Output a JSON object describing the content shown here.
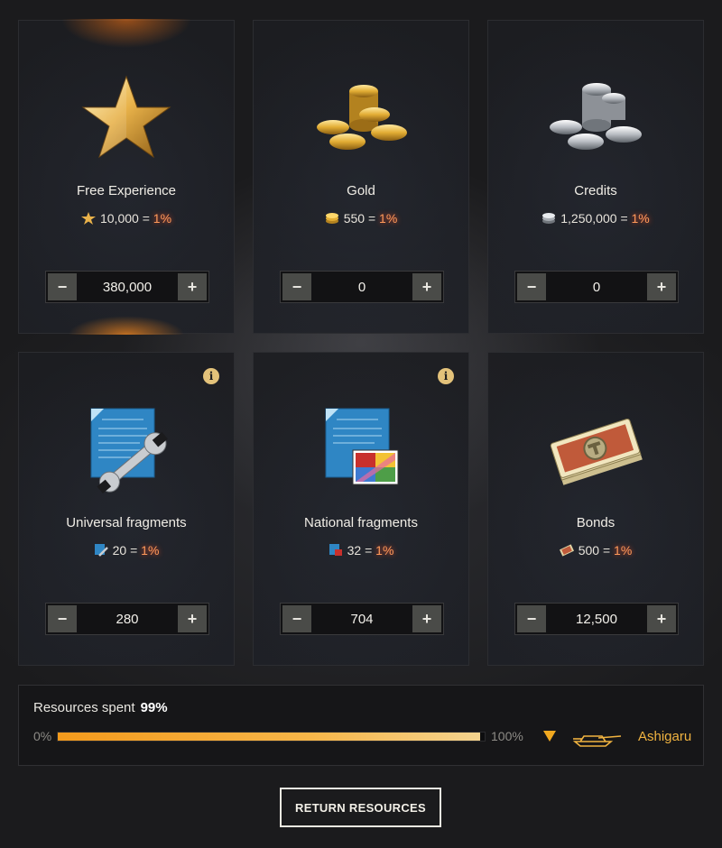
{
  "cards": [
    {
      "title": "Free Experience",
      "rate_amount": "10,000",
      "rate_eq": "=",
      "rate_pct": "1%",
      "value": "380,000",
      "icon": "star-icon",
      "minus": "−",
      "plus": "+"
    },
    {
      "title": "Gold",
      "rate_amount": "550",
      "rate_eq": "=",
      "rate_pct": "1%",
      "value": "0",
      "icon": "gold-coins-icon",
      "minus": "−",
      "plus": "+"
    },
    {
      "title": "Credits",
      "rate_amount": "1,250,000",
      "rate_eq": "=",
      "rate_pct": "1%",
      "value": "0",
      "icon": "credits-coins-icon",
      "minus": "−",
      "plus": "+"
    },
    {
      "title": "Universal fragments",
      "rate_amount": "20",
      "rate_eq": "=",
      "rate_pct": "1%",
      "value": "280",
      "icon": "universal-fragments-icon",
      "info": "i",
      "minus": "−",
      "plus": "+"
    },
    {
      "title": "National fragments",
      "rate_amount": "32",
      "rate_eq": "=",
      "rate_pct": "1%",
      "value": "704",
      "icon": "national-fragments-icon",
      "info": "i",
      "minus": "−",
      "plus": "+"
    },
    {
      "title": "Bonds",
      "rate_amount": "500",
      "rate_eq": "=",
      "rate_pct": "1%",
      "value": "12,500",
      "icon": "bonds-icon",
      "minus": "−",
      "plus": "+"
    }
  ],
  "spent": {
    "label": "Resources spent",
    "value": "99%",
    "progress_percent": 99,
    "min_label": "0%",
    "max_label": "100%",
    "tank_name": "Ashigaru"
  },
  "return_button": "RETURN RESOURCES",
  "colors": {
    "accent": "#f0b340",
    "percent": "#ff9a5a",
    "bar_start": "#f39a1c",
    "bar_end": "#f4d38e"
  }
}
